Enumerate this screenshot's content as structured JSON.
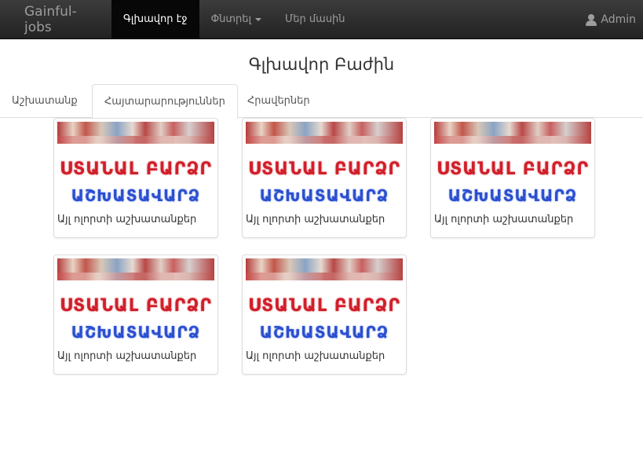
{
  "navbar": {
    "brand": "Gainful-jobs",
    "items": [
      {
        "label": "Գլխավոր էջ",
        "active": true
      },
      {
        "label": "Փնտրել",
        "dropdown": true
      },
      {
        "label": "Մեր մասին"
      }
    ],
    "user": "Admin"
  },
  "page_title": "Գլխավոր Բաժին",
  "tabs": [
    {
      "label": "Աշխատանք"
    },
    {
      "label": "Հայտարարություններ",
      "active": true
    },
    {
      "label": "Հրավերներ"
    }
  ],
  "cards": [
    {
      "image_line1": "ՍՏԱՆԱԼ ԲԱՐՁՐ",
      "image_line2": "ԱՇԽԱՏԱՎԱՐՁ",
      "caption": "Այլ ոլորտի աշխատանքեր"
    },
    {
      "image_line1": "ՍՏԱՆԱԼ ԲԱՐՁՐ",
      "image_line2": "ԱՇԽԱՏԱՎԱՐՁ",
      "caption": "Այլ ոլորտի աշխատանքեր"
    },
    {
      "image_line1": "ՍՏԱՆԱԼ ԲԱՐՁՐ",
      "image_line2": "ԱՇԽԱՏԱՎԱՐՁ",
      "caption": "Այլ ոլորտի աշխատանքեր"
    },
    {
      "image_line1": "ՍՏԱՆԱԼ ԲԱՐՁՐ",
      "image_line2": "ԱՇԽԱՏԱՎԱՐՁ",
      "caption": "Այլ ոլորտի աշխատանքեր"
    },
    {
      "image_line1": "ՍՏԱՆԱԼ ԲԱՐՁՐ",
      "image_line2": "ԱՇԽԱՏԱՎԱՐՁ",
      "caption": "Այլ ոլորտի աշխատանքեր"
    }
  ],
  "colors": {
    "navbar_bg": "#222222",
    "active_nav_bg": "#080808",
    "ad_red": "#d11f2a",
    "ad_blue": "#2a4fd0"
  }
}
